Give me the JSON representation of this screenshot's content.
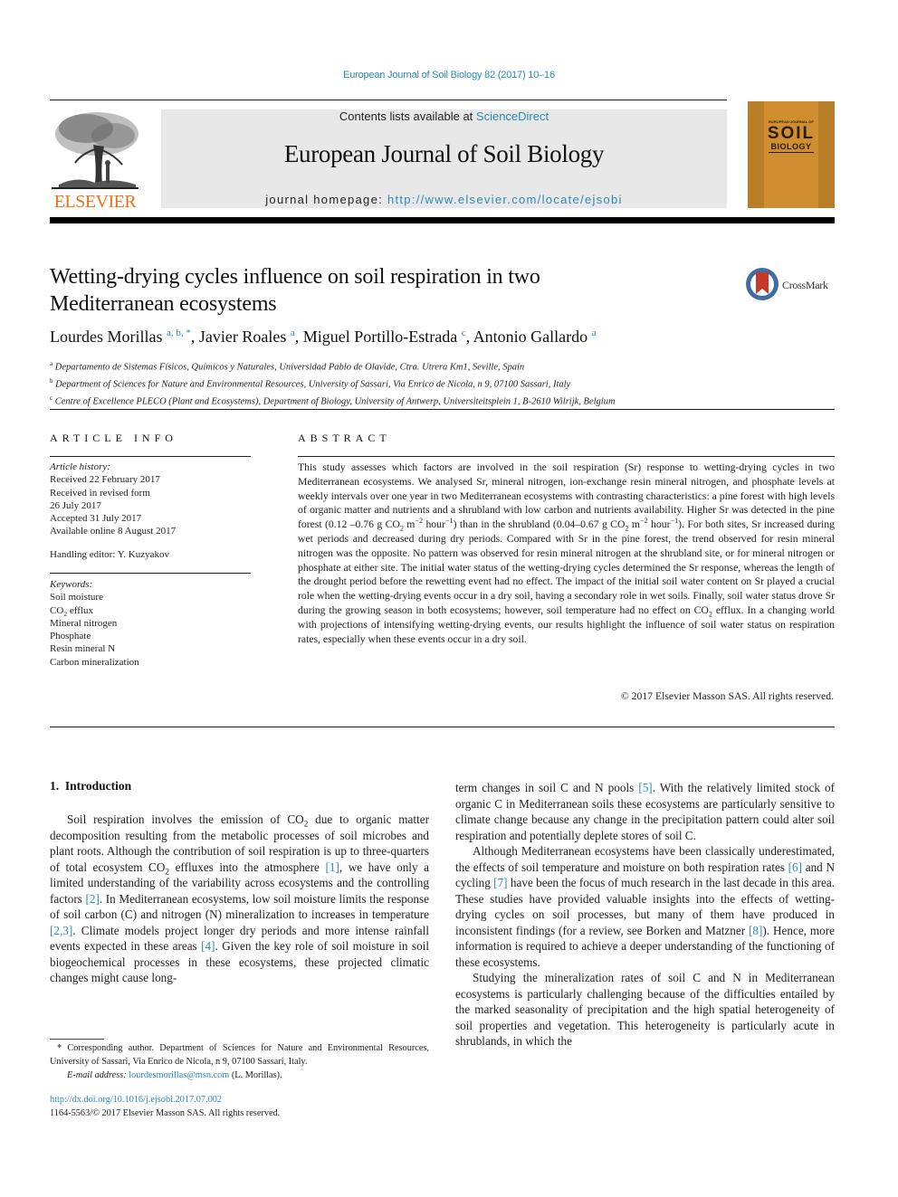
{
  "running_head": "European Journal of Soil Biology 82 (2017) 10–16",
  "masthead": {
    "contents_prefix": "Contents lists available at ",
    "contents_link": "ScienceDirect",
    "journal_name": "European Journal of Soil Biology",
    "homepage_prefix": "journal homepage: ",
    "homepage_link": "http://www.elsevier.com/locate/ejsobi",
    "publisher_logo_text": "ELSEVIER",
    "publisher_color": "#e8731a",
    "link_color": "#2a8ab8"
  },
  "cover": {
    "small_text": "EUROPEAN JOURNAL OF",
    "line1": "SOIL",
    "line2": "BIOLOGY"
  },
  "crossmark": {
    "label": "CrossMark"
  },
  "article": {
    "title_line1": "Wetting-drying cycles influence on soil respiration in two",
    "title_line2": "Mediterranean ecosystems",
    "authors": [
      {
        "name": "Lourdes Morillas",
        "sup": "a, b, *",
        "sep": ", "
      },
      {
        "name": "Javier Roales",
        "sup": "a",
        "sep": ", "
      },
      {
        "name": "Miguel Portillo-Estrada",
        "sup": "c",
        "sep": ", "
      },
      {
        "name": "Antonio Gallardo",
        "sup": "a",
        "sep": ""
      }
    ],
    "affiliations": [
      {
        "key": "a",
        "text": "Departamento de Sistemas Físicos, Químicos y Naturales, Universidad Pablo de Olavide, Ctra. Utrera Km1, Seville, Spain"
      },
      {
        "key": "b",
        "text": "Department of Sciences for Nature and Environmental Resources, University of Sassari, Via Enrico de Nicola, n 9, 07100 Sassari, Italy"
      },
      {
        "key": "c",
        "text": "Centre of Excellence PLECO (Plant and Ecosystems), Department of Biology, University of Antwerp, Universiteitsplein 1, B-2610 Wilrijk, Belgium"
      }
    ]
  },
  "article_info": {
    "heading": "ARTICLE INFO",
    "history_label": "Article history:",
    "history": [
      "Received 22 February 2017",
      "Received in revised form",
      "26 July 2017",
      "Accepted 31 July 2017",
      "Available online 8 August 2017"
    ],
    "editor": "Handling editor: Y. Kuzyakov",
    "keywords_label": "Keywords:",
    "keywords": [
      "Soil moisture",
      "CO2 efflux",
      "Mineral nitrogen",
      "Phosphate",
      "Resin mineral N",
      "Carbon mineralization"
    ]
  },
  "abstract": {
    "heading": "ABSTRACT",
    "text_part1": "This study assesses which factors are involved in the soil respiration (Sr) response to wetting-drying cycles in two Mediterranean ecosystems. We analysed Sr, mineral nitrogen, ion-exchange resin mineral nitrogen, and phosphate levels at weekly intervals over one year in two Mediterranean ecosystems with contrasting characteristics: a pine forest with high levels of organic matter and nutrients and a shrubland with low carbon and nutrients availability. Higher Sr was detected in the pine forest (0.12 –0.76 g CO",
    "text_part2": " m",
    "text_part3": " hour",
    "text_part4": ") than in the shrubland (0.04–0.67 g CO",
    "text_part5": ". For both sites, Sr increased during wet periods and decreased during dry periods. Compared with Sr in the pine forest, the trend observed for resin mineral nitrogen was the opposite. No pattern was observed for resin mineral nitrogen at the shrubland site, or for mineral nitrogen or phosphate at either site. The initial water status of the wetting-drying cycles determined the Sr response, whereas the length of the drought period before the rewetting event had no effect. The impact of the initial soil water content on Sr played a crucial role when the wetting-drying events occur in a dry soil, having a secondary role in wet soils. Finally, soil water status drove Sr during the growing season in both ecosystems; however, soil temperature had no effect on CO",
    "text_part6": " efflux. In a changing world with projections of intensifying wetting-drying events, our results highlight the influence of soil water status on respiration rates, especially when these events occur in a dry soil.",
    "copyright": "© 2017 Elsevier Masson SAS. All rights reserved."
  },
  "introduction": {
    "heading": "1.  Introduction",
    "left_p1": [
      "Soil respiration involves the emission of CO",
      " due to organic matter decomposition resulting from the metabolic processes of soil microbes and plant roots. Although the contribution of soil respiration is up to three-quarters of total ecosystem CO",
      " effluxes into the atmosphere ",
      "[1]",
      ", we have only a limited understanding of the variability across ecosystems and the controlling factors ",
      "[2]",
      ". In Mediterranean ecosystems, low soil moisture limits the response of soil carbon (C) and nitrogen (N) mineralization to increases in temperature ",
      "[2,3]",
      ". Climate models project longer dry periods and more intense rainfall events expected in these areas ",
      "[4]",
      ". Given the key role of soil moisture in soil biogeochemical processes in these ecosystems, these projected climatic changes might cause long-"
    ],
    "right_p1": [
      "term changes in soil C and N pools ",
      "[5]",
      ". With the relatively limited stock of organic C in Mediterranean soils these ecosystems are particularly sensitive to climate change because any change in the precipitation pattern could alter soil respiration and potentially deplete stores of soil C."
    ],
    "right_p2": [
      "Although Mediterranean ecosystems have been classically underestimated, the effects of soil temperature and moisture on both respiration rates ",
      "[6]",
      " and N cycling ",
      "[7]",
      " have been the focus of much research in the last decade in this area. These studies have provided valuable insights into the effects of wetting-drying cycles on soil processes, but many of them have produced in inconsistent findings (for a review, see Borken and Matzner ",
      "[8]",
      "). Hence, more information is required to achieve a deeper understanding of the functioning of these ecosystems."
    ],
    "right_p3": "Studying the mineralization rates of soil C and N in Mediterranean ecosystems is particularly challenging because of the difficulties entailed by the marked seasonality of precipitation and the high spatial heterogeneity of soil properties and vegetation. This heterogeneity is particularly acute in shrublands, in which the"
  },
  "footnote": {
    "corresponding": "* Corresponding author. Department of Sciences for Nature and Environmental Resources, University of Sassari, Via Enrico de Nicola, n 9, 07100 Sassari, Italy.",
    "email_label": "E-mail address: ",
    "email": "lourdesmorillas@msn.com",
    "email_suffix": " (L. Morillas).",
    "doi": "http://dx.doi.org/10.1016/j.ejsobi.2017.07.002",
    "issn": "1164-5563/© 2017 Elsevier Masson SAS. All rights reserved."
  },
  "sub2": "2",
  "sup_m2": "−2",
  "sup_m1": "−1"
}
